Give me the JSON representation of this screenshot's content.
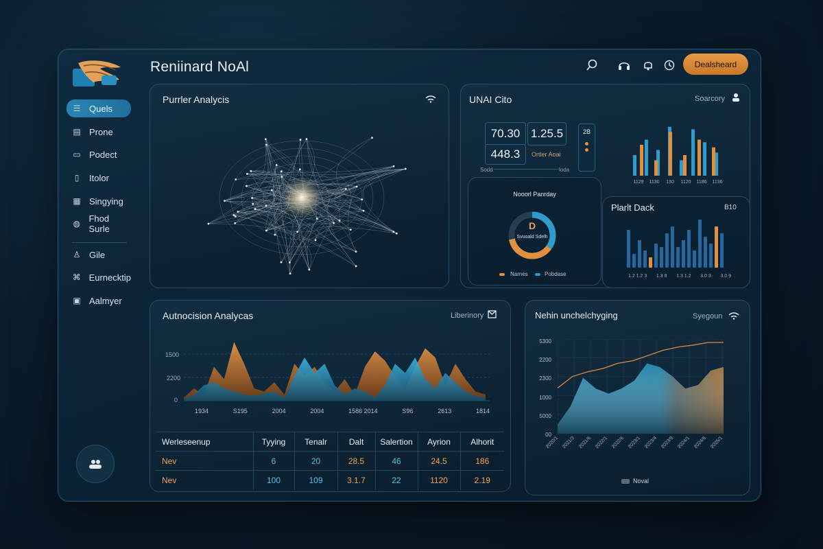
{
  "app": {
    "title": "Reniinard NoAl",
    "primary_button": "Dealsheard"
  },
  "colors": {
    "accent_orange": "#e89a48",
    "accent_blue": "#3fa7d2",
    "panel_border": "#294c62",
    "background": "#0a1c2b"
  },
  "header": {
    "icons": [
      "search-icon",
      "headset-icon",
      "bell-icon",
      "clock-icon"
    ]
  },
  "sidebar": {
    "items": [
      {
        "label": "Quels",
        "icon": "dashboard-icon",
        "active": true
      },
      {
        "label": "Prone",
        "icon": "folder-icon"
      },
      {
        "label": "Podect",
        "icon": "doc-icon"
      },
      {
        "label": "Itolor",
        "icon": "file-icon"
      },
      {
        "label": "Singying",
        "icon": "grid-icon"
      },
      {
        "label": "Fhod Surle",
        "icon": "globe-icon"
      },
      {
        "label": "Gile",
        "icon": "user-icon"
      },
      {
        "label": "Eurnecktip",
        "icon": "network-icon"
      },
      {
        "label": "Aalmyer",
        "icon": "box-icon"
      }
    ],
    "footer_icon": "people-icon"
  },
  "network_panel": {
    "title": "Purrler Analycis",
    "icon": "wifi-icon"
  },
  "stats_panel": {
    "title": "UNAI Cito",
    "subtitle": "Soarcory",
    "icon": "user-icon",
    "values": {
      "a": "70.30",
      "b": "1.25.5",
      "c": "448.3",
      "c_note": "Ortler Aoai",
      "d_left": "Sodd",
      "d_right": "loda",
      "mini": "2B"
    },
    "donut": {
      "title": "Nooorl Panrday",
      "center_label": "D",
      "center_sub": "Svuoald Sdelh",
      "legend": [
        "Narnes",
        "Pobdase"
      ],
      "value_fraction": 0.72
    },
    "bar_small_ticks": [
      "1129",
      "1130",
      "130",
      "1120",
      "1186",
      "1136"
    ],
    "bar_small": {
      "orange": [
        60,
        30,
        85,
        40,
        70,
        55
      ],
      "blue": [
        40,
        70,
        50,
        95,
        30,
        90,
        65,
        45
      ]
    },
    "plan_panel": {
      "title": "Plarlt Dack",
      "value": "B10",
      "ticks": [
        "1.2 1.2 3",
        "1.3 8",
        "1.3 1.2",
        "3.0 3",
        "3.0 9"
      ]
    }
  },
  "autonomous_panel": {
    "title": "Autnocision Analycas",
    "subtitle": "Liberinory",
    "icon": "mail-icon",
    "chart_data": {
      "type": "area",
      "y_ticks": [
        "1500",
        "2200",
        "0"
      ],
      "x_ticks": [
        "1934",
        "S195",
        "2004",
        "2004",
        "1586 2014",
        "S96",
        "2613",
        "1814"
      ],
      "series": [
        {
          "values": [
            5,
            20,
            10,
            55,
            35,
            95,
            60,
            20,
            15,
            30,
            10,
            60,
            40,
            55,
            30,
            15,
            35,
            10,
            55,
            80,
            65,
            40,
            20,
            55,
            85,
            70,
            25,
            60,
            35,
            15,
            10
          ]
        },
        {
          "values": [
            3,
            10,
            25,
            30,
            20,
            15,
            10,
            8,
            12,
            15,
            5,
            40,
            70,
            45,
            60,
            25,
            10,
            20,
            15,
            5,
            25,
            60,
            45,
            70,
            35,
            20,
            45,
            30,
            15,
            8,
            5
          ]
        }
      ]
    },
    "table": {
      "headers": [
        "Werleseenup",
        "Tyying",
        "Tenalr",
        "Dalt",
        "Salertion",
        "Ayrion",
        "Alhorit"
      ],
      "rows": [
        [
          "Nev",
          "6",
          "20",
          "28.5",
          "46",
          "24.5",
          "186"
        ],
        [
          "Nev",
          "100",
          "109",
          "3.1.7",
          "22",
          "1120",
          "2.19"
        ]
      ]
    }
  },
  "machine_panel": {
    "title": "Nehin unchelchyging",
    "subtitle": "Syegoun",
    "icon": "wifi-icon",
    "legend": "Noval",
    "chart_data": {
      "type": "area",
      "y_ticks": [
        "5300",
        "2200",
        "2300",
        "1000",
        "5000",
        "00"
      ],
      "x_ticks": [
        "2020/1",
        "2021/3",
        "2021/6",
        "2022/1",
        "2022/6",
        "2023/1",
        "2023/4",
        "2023/9",
        "2024/1",
        "2024/6",
        "2025/1"
      ],
      "area_values": [
        0.05,
        0.3,
        0.7,
        0.55,
        0.48,
        0.55,
        0.66,
        0.9,
        0.85,
        0.72,
        0.55,
        0.6,
        0.8,
        0.85
      ],
      "line_values": [
        0.3,
        0.48,
        0.55,
        0.6,
        0.68,
        0.72,
        0.8,
        0.88,
        0.93,
        0.96,
        1.0,
        1.0
      ]
    }
  }
}
